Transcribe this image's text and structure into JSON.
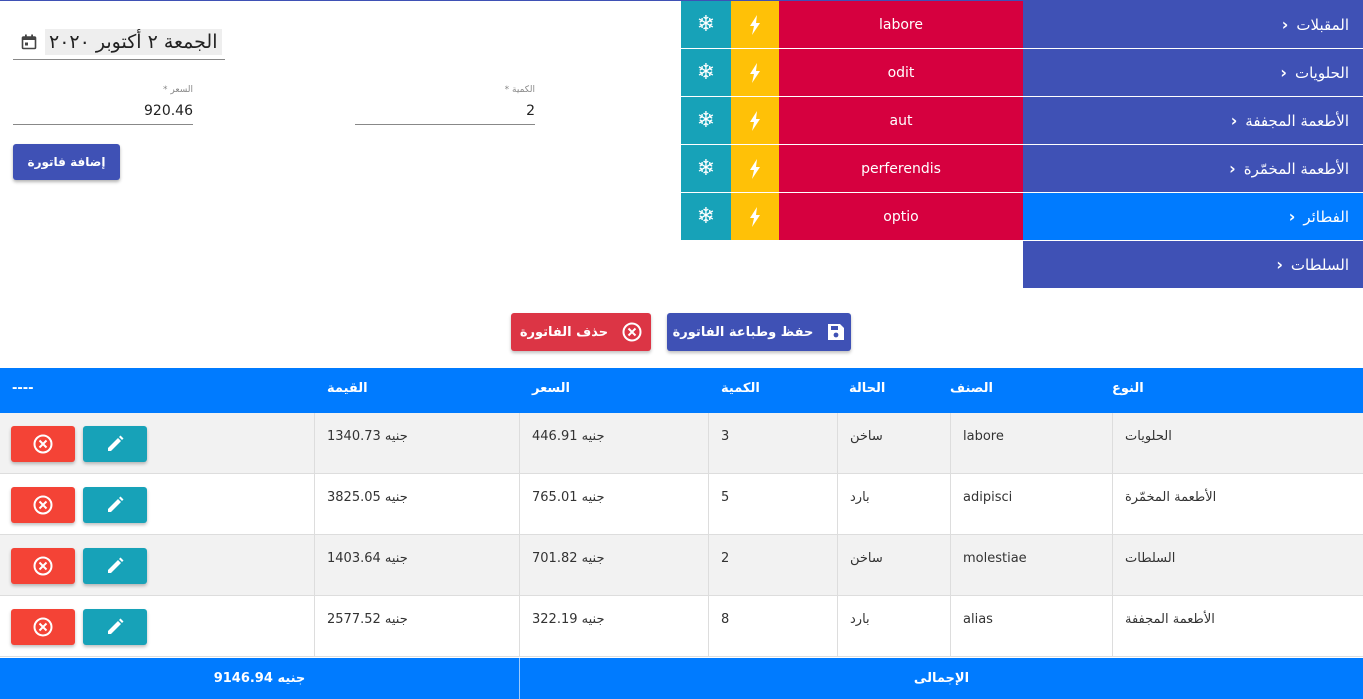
{
  "colors": {
    "indigo": "#3f51b5",
    "active_blue": "#007bff",
    "crimson": "#d6003f",
    "teal": "#17a2b8",
    "amber": "#ffc107",
    "red": "#dc3545",
    "row_del": "#f44336"
  },
  "categories": [
    {
      "label": "المقبلات",
      "active": false
    },
    {
      "label": "الحلويات",
      "active": false
    },
    {
      "label": "الأطعمة المجففة",
      "active": false
    },
    {
      "label": "الأطعمة المخمّرة",
      "active": false
    },
    {
      "label": "الفطائر",
      "active": true
    },
    {
      "label": "السلطات",
      "active": false
    }
  ],
  "products": [
    {
      "name": "labore"
    },
    {
      "name": "odit"
    },
    {
      "name": "aut"
    },
    {
      "name": "perferendis"
    },
    {
      "name": "optio"
    }
  ],
  "form": {
    "date_text": "الجمعة ٢ أكتوبر ٢٠٢٠",
    "quantity_label": "الكمية *",
    "quantity_value": "2",
    "price_label": "السعر *",
    "price_value": "920.46",
    "add_invoice_label": "إضافة فاتورة"
  },
  "actions": {
    "save_print_label": "حفظ وطباعة الفاتورة",
    "delete_invoice_label": "حذف الفاتورة"
  },
  "table": {
    "headers": {
      "type": "النوع",
      "item": "الصنف",
      "status": "الحالة",
      "qty": "الكمية",
      "price": "السعر",
      "value": "القيمة",
      "actions": "----"
    },
    "rows": [
      {
        "type": "الحلويات",
        "item": "labore",
        "status": "ساخن",
        "qty": "3",
        "price": "446.91 جنيه",
        "value": "1340.73 جنيه"
      },
      {
        "type": "الأطعمة المخمّرة",
        "item": "adipisci",
        "status": "بارد",
        "qty": "5",
        "price": "765.01 جنيه",
        "value": "3825.05 جنيه"
      },
      {
        "type": "السلطات",
        "item": "molestiae",
        "status": "ساخن",
        "qty": "2",
        "price": "701.82 جنيه",
        "value": "1403.64 جنيه"
      },
      {
        "type": "الأطعمة المجففة",
        "item": "alias",
        "status": "بارد",
        "qty": "8",
        "price": "322.19 جنيه",
        "value": "2577.52 جنيه"
      }
    ],
    "footer": {
      "total_label": "الإجمالى",
      "total_value": "9146.94 جنيه"
    }
  }
}
